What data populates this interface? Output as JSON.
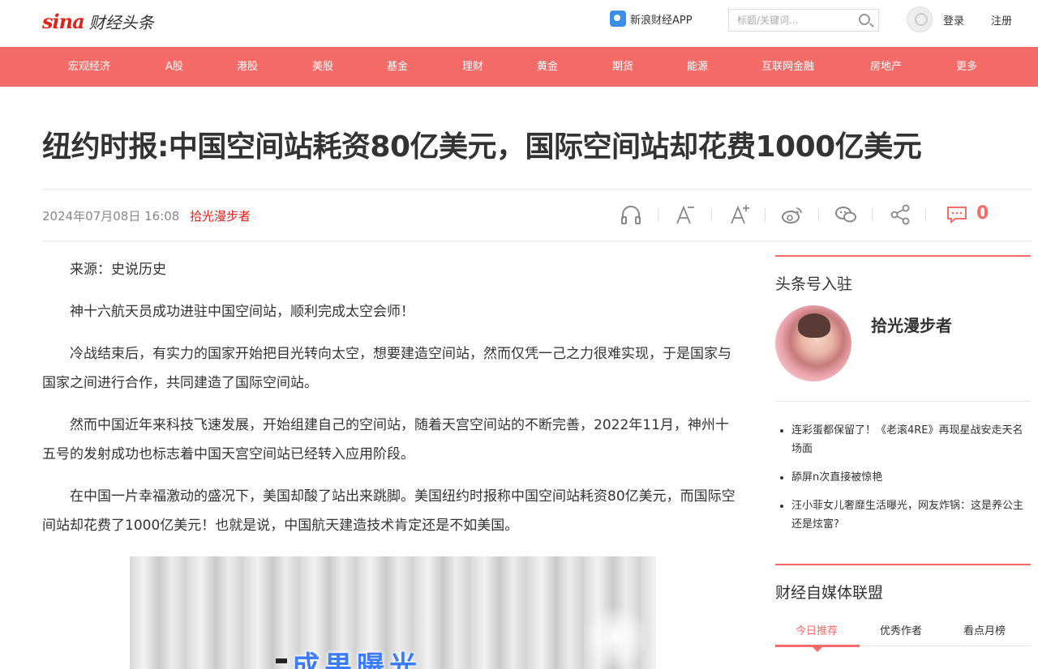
{
  "header": {
    "logo_text": "财经头条",
    "logo_brand": "sina",
    "app_label": "新浪财经APP",
    "search_placeholder": "标题/关键词...",
    "login": "登录",
    "register": "注册"
  },
  "nav": {
    "items": [
      "宏观经济",
      "A股",
      "港股",
      "美股",
      "基金",
      "理财",
      "黄金",
      "期货",
      "能源",
      "互联网金融",
      "房地产",
      "更多"
    ]
  },
  "article": {
    "title": "纽约时报:中国空间站耗资80亿美元，国际空间站却花费1000亿美元",
    "date": "2024年07月08日 16:08",
    "author": "拾光漫步者",
    "comment_count": "0",
    "paragraphs": [
      "来源：史说历史",
      "神十六航天员成功进驻中国空间站，顺利完成太空会师！",
      "冷战结束后，有实力的国家开始把目光转向太空，想要建造空间站，然而仅凭一己之力很难实现，于是国家与国家之间进行合作，共同建造了国际空间站。",
      "然而中国近年来科技飞速发展，开始组建自己的空间站，随着天宫空间站的不断完善，2022年11月，神州十五号的发射成功也标志着中国天宫空间站已经转入应用阶段。",
      "在中国一片幸福激动的盛况下，美国却酸了站出来跳脚。美国纽约时报称中国空间站耗资80亿美元，而国际空间站却花费了1000亿美元！也就是说，中国航天建造技术肯定还是不如美国。"
    ],
    "image_caption": "成果曝光"
  },
  "toolbar": {
    "icons": [
      "headphones-icon",
      "font-decrease-icon",
      "font-increase-icon",
      "weibo-icon",
      "wechat-icon",
      "share-icon",
      "comment-icon"
    ]
  },
  "sidebar": {
    "section1_title": "头条号入驻",
    "author_name": "拾光漫步者",
    "news": [
      "连彩蛋都保留了！《老滚4RE》再现星战安走天名场面",
      "舔屏n次直接被惊艳",
      "汪小菲女儿奢靡生活曝光，网友炸锅：这是养公主还是炫富?"
    ],
    "section2_title": "财经自媒体联盟",
    "tabs": [
      "今日推荐",
      "优秀作者",
      "看点月榜"
    ]
  },
  "colors": {
    "accent": "#f56b68",
    "brand_red": "#e2231a"
  }
}
